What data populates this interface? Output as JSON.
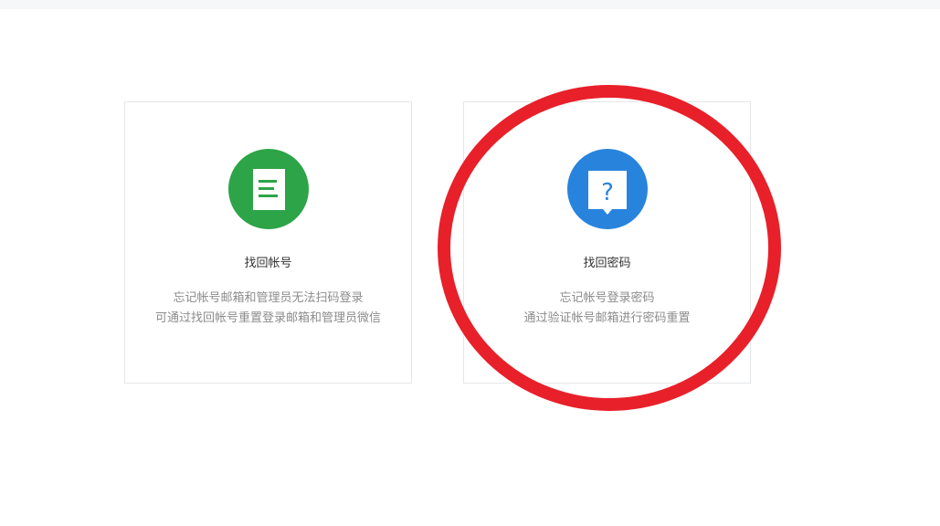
{
  "cards": [
    {
      "title": "找回帐号",
      "desc_line1": "忘记帐号邮箱和管理员无法扫码登录",
      "desc_line2": "可通过找回帐号重置登录邮箱和管理员微信",
      "icon": "document-icon",
      "color": "#2da447"
    },
    {
      "title": "找回密码",
      "desc_line1": "忘记帐号登录密码",
      "desc_line2": "通过验证帐号邮箱进行密码重置",
      "icon": "question-bubble-icon",
      "color": "#2883dd"
    }
  ],
  "annotation": {
    "color": "#e8202a"
  }
}
